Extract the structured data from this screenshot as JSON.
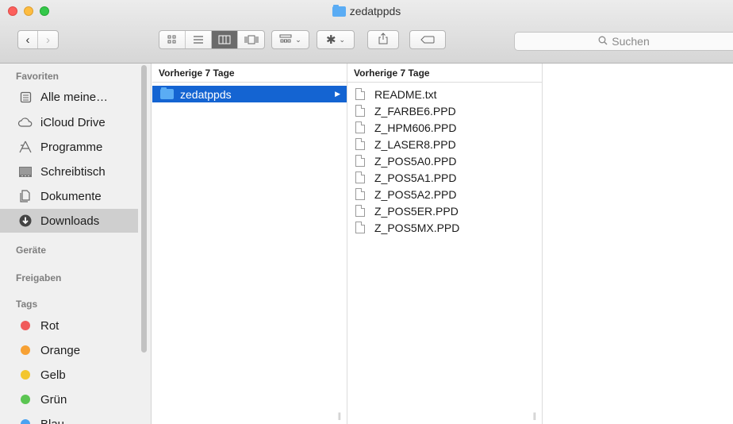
{
  "window": {
    "title": "zedatppds"
  },
  "toolbar": {
    "search_placeholder": "Suchen",
    "view_icons": [
      "icon-view-icon",
      "list-view-icon",
      "column-view-icon",
      "coverflow-view-icon"
    ],
    "arrange_icon": "arrange-icon",
    "action_icon": "gear-icon",
    "share_icon": "share-icon",
    "tag_icon": "tag-icon"
  },
  "sidebar": {
    "favorites_heading": "Favoriten",
    "favorites": [
      {
        "label": "Alle meine…",
        "icon": "all-files-icon"
      },
      {
        "label": "iCloud Drive",
        "icon": "cloud-icon"
      },
      {
        "label": "Programme",
        "icon": "applications-icon"
      },
      {
        "label": "Schreibtisch",
        "icon": "desktop-icon"
      },
      {
        "label": "Dokumente",
        "icon": "documents-icon"
      },
      {
        "label": "Downloads",
        "icon": "downloads-icon",
        "selected": true
      }
    ],
    "devices_heading": "Geräte",
    "shared_heading": "Freigaben",
    "tags_heading": "Tags",
    "tags": [
      {
        "label": "Rot",
        "color": "#f05a5a"
      },
      {
        "label": "Orange",
        "color": "#f7a134"
      },
      {
        "label": "Gelb",
        "color": "#f3c62e"
      },
      {
        "label": "Grün",
        "color": "#5bc552"
      },
      {
        "label": "Blau",
        "color": "#4aa2f1"
      }
    ]
  },
  "columns": [
    {
      "heading": "Vorherige 7 Tage",
      "items": [
        {
          "label": "zedatppds",
          "type": "folder",
          "selected": true
        }
      ]
    },
    {
      "heading": "Vorherige 7 Tage",
      "items": [
        {
          "label": "README.txt"
        },
        {
          "label": "Z_FARBE6.PPD"
        },
        {
          "label": "Z_HPM606.PPD"
        },
        {
          "label": "Z_LASER8.PPD"
        },
        {
          "label": "Z_POS5A0.PPD"
        },
        {
          "label": "Z_POS5A1.PPD"
        },
        {
          "label": "Z_POS5A2.PPD"
        },
        {
          "label": "Z_POS5ER.PPD"
        },
        {
          "label": "Z_POS5MX.PPD"
        }
      ]
    }
  ],
  "colors": {
    "selection": "#1464d2",
    "folder": "#5aacf4"
  }
}
